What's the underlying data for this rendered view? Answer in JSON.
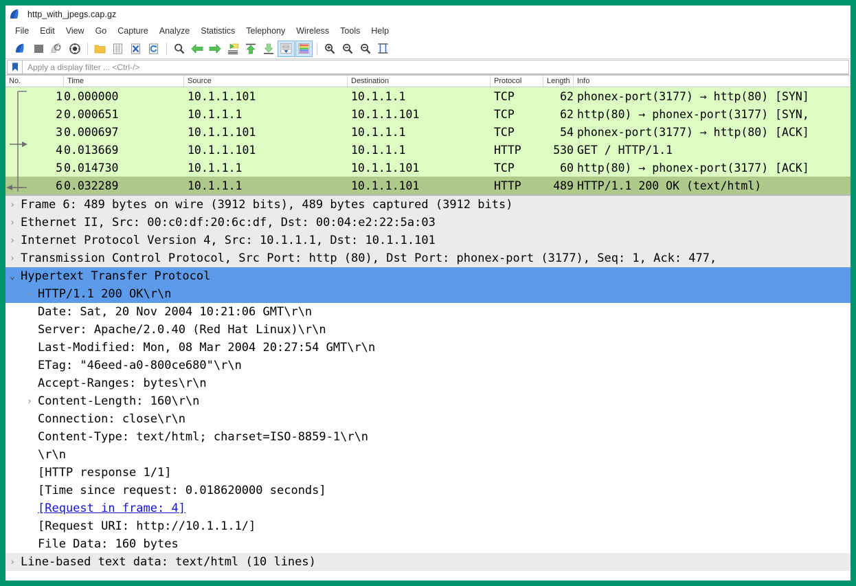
{
  "window": {
    "title": "http_with_jpegs.cap.gz",
    "logo_icon": "wireshark-shark-fin-icon",
    "border_color": "#00936e"
  },
  "menubar": {
    "items": [
      {
        "label": "File"
      },
      {
        "label": "Edit"
      },
      {
        "label": "View"
      },
      {
        "label": "Go"
      },
      {
        "label": "Capture"
      },
      {
        "label": "Analyze"
      },
      {
        "label": "Statistics"
      },
      {
        "label": "Telephony"
      },
      {
        "label": "Wireless"
      },
      {
        "label": "Tools"
      },
      {
        "label": "Help"
      }
    ]
  },
  "toolbar": {
    "buttons": [
      {
        "name": "start-capture-icon",
        "tooltip": "Start capturing packets"
      },
      {
        "name": "stop-capture-icon",
        "tooltip": "Stop capturing packets"
      },
      {
        "name": "restart-capture-icon",
        "tooltip": "Restart current capture"
      },
      {
        "name": "capture-options-icon",
        "tooltip": "Capture options"
      },
      {
        "name": "open-file-icon",
        "tooltip": "Open a capture file"
      },
      {
        "name": "save-file-icon",
        "tooltip": "Save this capture file"
      },
      {
        "name": "close-file-icon",
        "tooltip": "Close this capture file"
      },
      {
        "name": "reload-file-icon",
        "tooltip": "Reload this file"
      },
      {
        "name": "find-packet-icon",
        "tooltip": "Find a packet"
      },
      {
        "name": "go-back-icon",
        "tooltip": "Go back in packet history"
      },
      {
        "name": "go-forward-icon",
        "tooltip": "Go forward in packet history"
      },
      {
        "name": "go-to-packet-icon",
        "tooltip": "Go to the packet"
      },
      {
        "name": "go-to-first-packet-icon",
        "tooltip": "Go to the first packet"
      },
      {
        "name": "go-to-last-packet-icon",
        "tooltip": "Go to the last packet"
      },
      {
        "name": "auto-scroll-icon",
        "tooltip": "Auto scroll in live capture",
        "selected": true
      },
      {
        "name": "colorize-packets-icon",
        "tooltip": "Colorize packet list",
        "selected": true
      },
      {
        "name": "zoom-in-icon",
        "tooltip": "Zoom in"
      },
      {
        "name": "zoom-out-icon",
        "tooltip": "Zoom out"
      },
      {
        "name": "normal-size-icon",
        "tooltip": "Normal size"
      },
      {
        "name": "resize-columns-icon",
        "tooltip": "Resize columns"
      }
    ]
  },
  "filter": {
    "bookmark_icon": "bookmark-icon",
    "placeholder": "Apply a display filter ... <Ctrl-/>",
    "value": ""
  },
  "packet_list": {
    "columns": [
      "No.",
      "Time",
      "Source",
      "Destination",
      "Protocol",
      "Length",
      "Info"
    ],
    "rows": [
      {
        "no": "1",
        "time": "0.000000",
        "source": "10.1.1.101",
        "destination": "10.1.1.1",
        "protocol": "TCP",
        "length": "62",
        "info": "phonex-port(3177) → http(80) [SYN]",
        "selected": false
      },
      {
        "no": "2",
        "time": "0.000651",
        "source": "10.1.1.1",
        "destination": "10.1.1.101",
        "protocol": "TCP",
        "length": "62",
        "info": "http(80) → phonex-port(3177) [SYN,",
        "selected": false
      },
      {
        "no": "3",
        "time": "0.000697",
        "source": "10.1.1.101",
        "destination": "10.1.1.1",
        "protocol": "TCP",
        "length": "54",
        "info": "phonex-port(3177) → http(80) [ACK]",
        "selected": false
      },
      {
        "no": "4",
        "time": "0.013669",
        "source": "10.1.1.101",
        "destination": "10.1.1.1",
        "protocol": "HTTP",
        "length": "530",
        "info": "GET / HTTP/1.1",
        "selected": false
      },
      {
        "no": "5",
        "time": "0.014730",
        "source": "10.1.1.1",
        "destination": "10.1.1.101",
        "protocol": "TCP",
        "length": "60",
        "info": "http(80) → phonex-port(3177) [ACK]",
        "selected": false
      },
      {
        "no": "6",
        "time": "0.032289",
        "source": "10.1.1.1",
        "destination": "10.1.1.101",
        "protocol": "HTTP",
        "length": "489",
        "info": "HTTP/1.1 200 OK  (text/html)",
        "selected": true
      }
    ]
  },
  "packet_detail": {
    "rows": [
      {
        "text": "Frame 6: 489 bytes on wire (3912 bits), 489 bytes captured (3912 bits)",
        "twisty": "collapsed",
        "indent": 0,
        "style": "grey"
      },
      {
        "text": "Ethernet II, Src: 00:c0:df:20:6c:df, Dst: 00:04:e2:22:5a:03",
        "twisty": "collapsed",
        "indent": 0,
        "style": "grey"
      },
      {
        "text": "Internet Protocol Version 4, Src: 10.1.1.1, Dst: 10.1.1.101",
        "twisty": "collapsed",
        "indent": 0,
        "style": "grey"
      },
      {
        "text": "Transmission Control Protocol, Src Port: http (80), Dst Port: phonex-port (3177), Seq: 1, Ack: 477,",
        "twisty": "collapsed",
        "indent": 0,
        "style": "grey"
      },
      {
        "text": "Hypertext Transfer Protocol",
        "twisty": "expanded",
        "indent": 0,
        "style": "selected"
      },
      {
        "text": "HTTP/1.1 200 OK\\r\\n",
        "twisty": "collapsed",
        "indent": 1,
        "style": "selected"
      },
      {
        "text": "Date: Sat, 20 Nov 2004 10:21:06 GMT\\r\\n",
        "twisty": "none",
        "indent": 1,
        "style": "plain"
      },
      {
        "text": "Server: Apache/2.0.40 (Red Hat Linux)\\r\\n",
        "twisty": "none",
        "indent": 1,
        "style": "plain"
      },
      {
        "text": "Last-Modified: Mon, 08 Mar 2004 20:27:54 GMT\\r\\n",
        "twisty": "none",
        "indent": 1,
        "style": "plain"
      },
      {
        "text": "ETag: \"46eed-a0-800ce680\"\\r\\n",
        "twisty": "none",
        "indent": 1,
        "style": "plain"
      },
      {
        "text": "Accept-Ranges: bytes\\r\\n",
        "twisty": "none",
        "indent": 1,
        "style": "plain"
      },
      {
        "text": "Content-Length: 160\\r\\n",
        "twisty": "collapsed",
        "indent": 1,
        "style": "plain"
      },
      {
        "text": "Connection: close\\r\\n",
        "twisty": "none",
        "indent": 1,
        "style": "plain"
      },
      {
        "text": "Content-Type: text/html; charset=ISO-8859-1\\r\\n",
        "twisty": "none",
        "indent": 1,
        "style": "plain"
      },
      {
        "text": "\\r\\n",
        "twisty": "none",
        "indent": 1,
        "style": "plain"
      },
      {
        "text": "[HTTP response 1/1]",
        "twisty": "none",
        "indent": 1,
        "style": "plain"
      },
      {
        "text": "[Time since request: 0.018620000 seconds]",
        "twisty": "none",
        "indent": 1,
        "style": "plain"
      },
      {
        "text": "[Request in frame: 4]",
        "twisty": "none",
        "indent": 1,
        "style": "link"
      },
      {
        "text": "[Request URI: http://10.1.1.1/]",
        "twisty": "none",
        "indent": 1,
        "style": "plain"
      },
      {
        "text": "File Data: 160 bytes",
        "twisty": "none",
        "indent": 1,
        "style": "plain"
      },
      {
        "text": "Line-based text data: text/html (10 lines)",
        "twisty": "collapsed",
        "indent": 0,
        "style": "grey"
      }
    ]
  },
  "colors": {
    "window_border": "#00936e",
    "packet_row_bg": "#ddfcc4",
    "packet_row_selected_bg": "#aec98a",
    "detail_selected_bg": "#5b9bea",
    "detail_toplevel_bg": "#ebebeb",
    "link_color": "#1414d2"
  }
}
